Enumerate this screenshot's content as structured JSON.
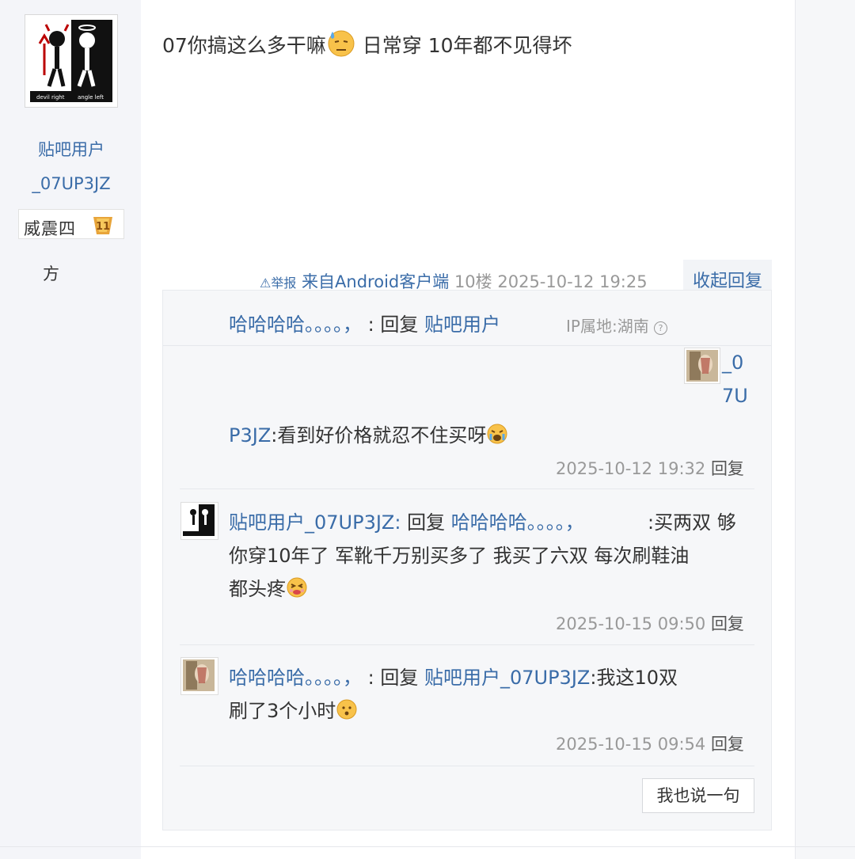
{
  "author": {
    "name_line1": "贴吧用户",
    "name_line2": "_07UP3JZ",
    "badge_text": "威震四",
    "badge_text2": "方",
    "badge_level": "11",
    "avatar_label_left": "devil right",
    "avatar_label_right": "angle left"
  },
  "post": {
    "text_before_emoji": "07你搞这么多干嘛",
    "text_after_emoji": " 日常穿 10年都不见得坏",
    "emoji": "sweat-face-icon",
    "report_label": "⚠举报",
    "client_label": "来自Android客户端",
    "floor": "10楼",
    "time": "2025-10-12 19:25",
    "fold_label": "收起回复"
  },
  "replies_header": {
    "user": "哈哈哈哈。。。。，",
    "reply_word": "回复",
    "target": "贴吧用户",
    "ip": "IP属地:湖南",
    "ip_icon": "?"
  },
  "replies": [
    {
      "user_line1": "_0",
      "user_line2": "7U",
      "user_line3": "P3JZ",
      "text": ":看到好价格就忍不住买呀",
      "time": "2025-10-12 19:32",
      "reply_label": "回复"
    },
    {
      "user": "贴吧用户_07UP3JZ:",
      "reply_word": "回复",
      "target": "哈哈哈哈。。。。，",
      "line1_text": ":买两双 够",
      "line2_text": "你穿10年了 军靴千万别买多了 我买了六双 每次刷鞋油",
      "line3_text": "都头疼",
      "time": "2025-10-15 09:50",
      "reply_label": "回复"
    },
    {
      "user": "哈哈哈哈。。。。，",
      "reply_word": "回复",
      "target": "贴吧用户_07UP3JZ",
      "line1_text": ":我这10双",
      "line2_text": "刷了3个小时",
      "time": "2025-10-15 09:54",
      "reply_label": "回复"
    }
  ],
  "say_button": "我也说一句"
}
